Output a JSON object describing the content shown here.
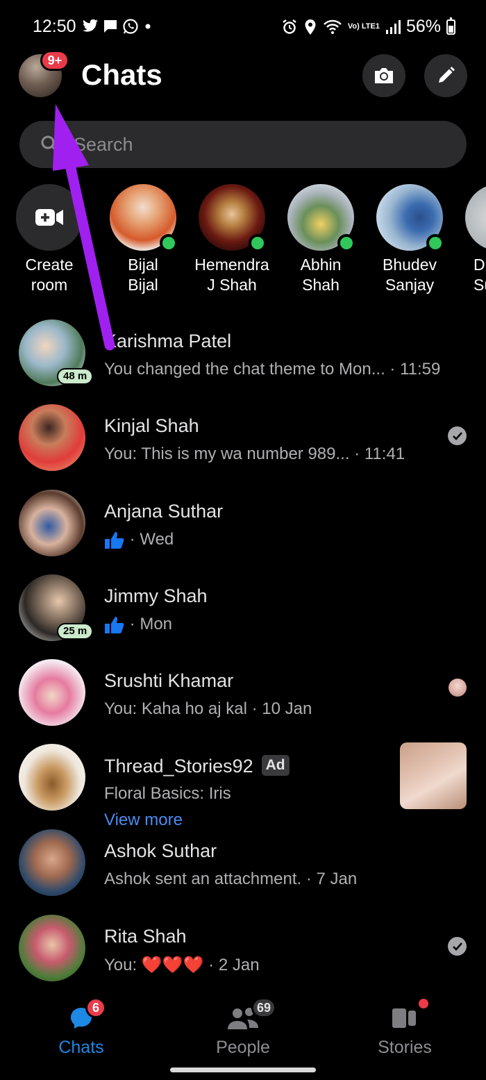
{
  "status_bar": {
    "time": "12:50",
    "network": "Vo) LTE1",
    "battery": "56%"
  },
  "header": {
    "title": "Chats",
    "profile_badge": "9+"
  },
  "search": {
    "placeholder": "Search"
  },
  "active_people": [
    {
      "name_line1": "Create",
      "name_line2": "room",
      "type": "create"
    },
    {
      "name_line1": "Bijal",
      "name_line2": "Bijal",
      "online": true
    },
    {
      "name_line1": "Hemendra",
      "name_line2": "J Shah",
      "online": true
    },
    {
      "name_line1": "Abhin",
      "name_line2": "Shah",
      "online": true
    },
    {
      "name_line1": "Bhudev",
      "name_line2": "Sanjay",
      "online": true
    },
    {
      "name_line1": "D",
      "name_line2": "Su",
      "online": false
    }
  ],
  "chats": [
    {
      "name": "Karishma Patel",
      "preview": "You changed the chat theme to Mon...",
      "time": "11:59",
      "active_badge": "48 m"
    },
    {
      "name": "Kinjal Shah",
      "preview": "You: This is my wa number  989...",
      "time": "11:41",
      "status": "read"
    },
    {
      "name": "Anjana Suthar",
      "preview": "",
      "time": "Wed",
      "preview_icon": "thumbs-up"
    },
    {
      "name": "Jimmy Shah",
      "preview": "",
      "time": "Mon",
      "preview_icon": "thumbs-up",
      "active_badge": "25 m"
    },
    {
      "name": "Srushti Khamar",
      "preview": "You: Kaha ho aj kal",
      "time": "10 Jan",
      "status": "seen"
    },
    {
      "name": "Thread_Stories92",
      "badge": "Ad",
      "preview": "Floral Basics: Iris",
      "link": "View more"
    },
    {
      "name": "Ashok Suthar",
      "preview": "Ashok sent an attachment.",
      "time": "7 Jan"
    },
    {
      "name": "Rita Shah",
      "preview": "You: ❤️❤️❤️",
      "time": "2 Jan",
      "status": "read"
    }
  ],
  "bottom_nav": {
    "chats": {
      "label": "Chats",
      "badge": "6"
    },
    "people": {
      "label": "People",
      "badge": "69"
    },
    "stories": {
      "label": "Stories"
    }
  },
  "colors": {
    "accent_blue": "#1e88e5",
    "link_blue": "#4a8cf2",
    "badge_red": "#ea3b4a",
    "online_green": "#31c85b",
    "annotation_purple": "#a020f0"
  }
}
